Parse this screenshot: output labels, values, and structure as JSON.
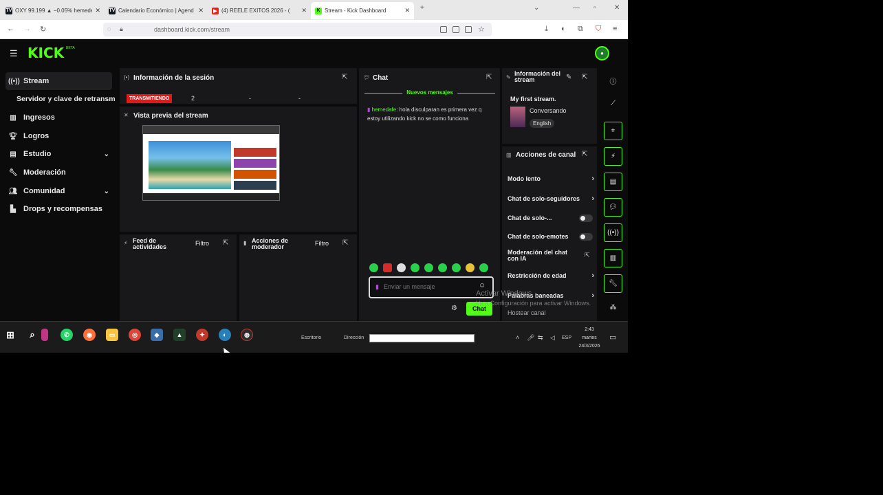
{
  "browser": {
    "tabs": [
      {
        "label": "OXY 99.199 ▲ −0.05% hemedel",
        "favicon": "tradingview-icon",
        "color": "#131722"
      },
      {
        "label": "Calendario Económico | Agend",
        "favicon": "tradingview-icon",
        "color": "#131722"
      },
      {
        "label": "(4) REELE EXITOS 2026 - (",
        "favicon": "youtube-icon",
        "color": "#e62117"
      },
      {
        "label": "Stream - Kick Dashboard",
        "favicon": "kick-icon",
        "color": "#53fc18"
      }
    ],
    "url": "dashboard.kick.com/stream"
  },
  "app": {
    "logo": "KICK",
    "logo_sup": "BETA",
    "sidebar": [
      {
        "label": "Stream",
        "icon": "stream-icon",
        "active": true
      },
      {
        "label": "Servidor y clave de retransm",
        "icon": ""
      },
      {
        "label": "Ingresos",
        "icon": "revenue-icon"
      },
      {
        "label": "Logros",
        "icon": "trophy-icon"
      },
      {
        "label": "Estudio",
        "icon": "studio-icon",
        "chevron": true
      },
      {
        "label": "Moderación",
        "icon": "wrench-icon"
      },
      {
        "label": "Comunidad",
        "icon": "community-icon",
        "chevron": true
      },
      {
        "label": "Drops y recompensas",
        "icon": "drops-icon"
      }
    ],
    "session": {
      "title": "Información de la sesión",
      "status": "TRANSMITIENDO",
      "viewers": "2",
      "stat2": "-",
      "stat3": "-"
    },
    "preview": {
      "title": "Vista previa del stream"
    },
    "feed": {
      "title": "Feed de actividades",
      "filter": "Filtro"
    },
    "modactions": {
      "title": "Acciones de moderador",
      "filter": "Filtro"
    },
    "chat": {
      "title": "Chat",
      "new_messages": "Nuevos mensajes",
      "message_user": "hemedafe",
      "message_text": ": hola disculparan es primera vez q estoy utilizando kick no se como funciona",
      "placeholder": "Enviar un mensaje",
      "send": "Chat"
    },
    "stream_info": {
      "title": "Información del stream",
      "stream_title": "My first stream.",
      "category": "Conversando",
      "language": "English"
    },
    "channel_actions": {
      "title": "Acciones de canal",
      "items": [
        {
          "label": "Modo lento",
          "type": "arrow"
        },
        {
          "label": "Chat de solo-seguidores",
          "type": "arrow"
        },
        {
          "label": "Chat de solo-...",
          "type": "toggle"
        },
        {
          "label": "Chat de solo-emotes",
          "type": "toggle"
        },
        {
          "label": "Moderación del chat con IA",
          "type": "external"
        },
        {
          "label": "Restricción de edad",
          "type": "arrow"
        },
        {
          "label": "Palabras baneadas",
          "type": "arrow"
        },
        {
          "label": "Hostear canal",
          "type": "none"
        }
      ]
    },
    "watermark": {
      "line1": "Activar Windows",
      "line2": "Ve a Configuración para activar Windows."
    }
  },
  "taskbar": {
    "desktop_label": "Escritorio",
    "address_label": "Dirección",
    "lang": "ESP",
    "time": "2:43",
    "day": "martes",
    "date": "24/3/2026"
  },
  "colors": {
    "accent": "#53fc18",
    "live": "#e31919",
    "panel": "#18181b",
    "bg": "#0b0b0c"
  }
}
